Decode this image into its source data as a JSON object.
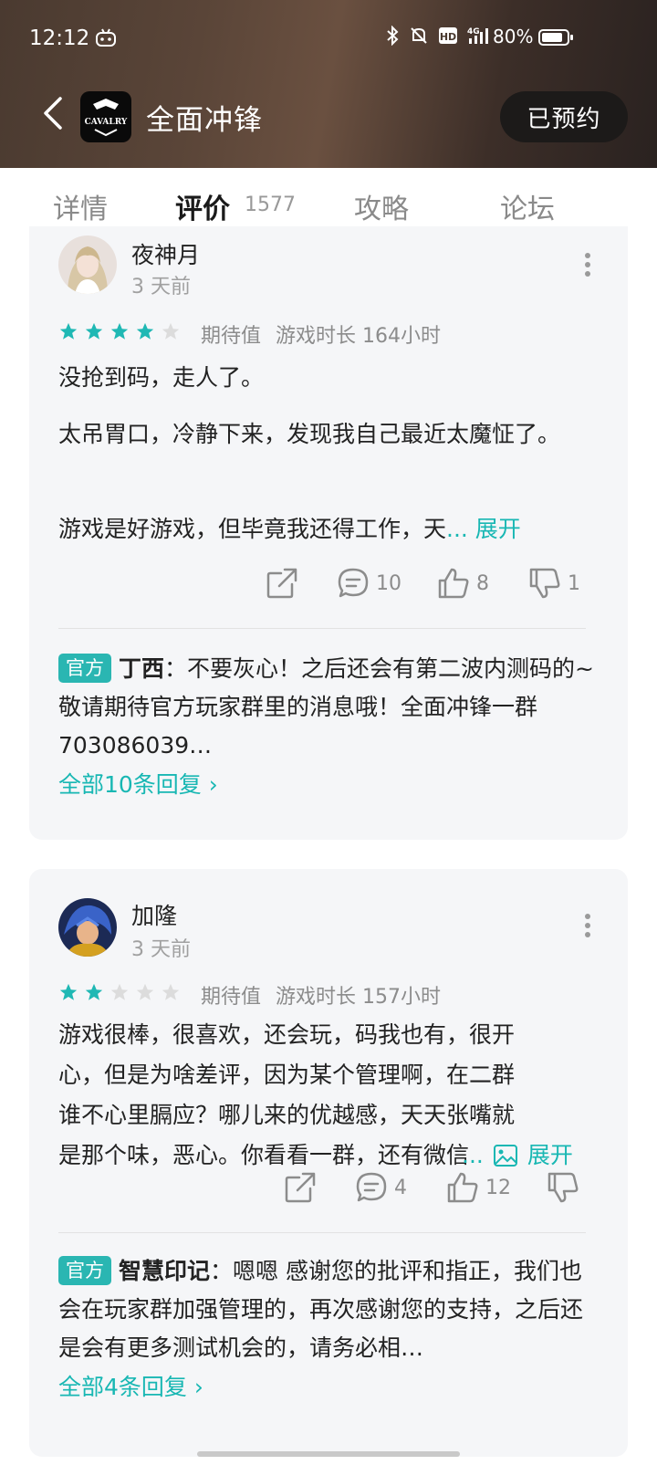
{
  "status_bar": {
    "time": "12:12",
    "battery": "80%",
    "icons": [
      "game-controller-icon",
      "bluetooth-icon",
      "mute-icon",
      "hd-icon",
      "4g-signal-icon",
      "battery-icon"
    ]
  },
  "header": {
    "title": "全面冲锋",
    "reserve_label": "已预约",
    "logo_text": "CAVALRY"
  },
  "tabs": [
    {
      "label": "详情"
    },
    {
      "label": "评价",
      "count": "1577",
      "active": true
    },
    {
      "label": "攻略"
    },
    {
      "label": "论坛"
    }
  ],
  "reviews": [
    {
      "user": "夜神月",
      "time": "3 天前",
      "stars": 4,
      "tag": "期待值",
      "playtime": "游戏时长 164小时",
      "paragraphs": [
        "没抢到码，走人了。",
        "太吊胃口，冷静下来，发现我自己最近太魔怔了。",
        "游戏是好游戏，但毕竟我还得工作，天"
      ],
      "expand_label": "... 展开",
      "comments": "10",
      "likes": "8",
      "dislikes": "1",
      "reply": {
        "badge": "官方",
        "author": "丁西",
        "text": "：不要灰心！之后还会有第二波内测码的~敬请期待官方玩家群里的消息哦！全面冲锋一群703086039…",
        "link": "全部10条回复 ›"
      }
    },
    {
      "user": "加隆",
      "time": "3 天前",
      "stars": 2,
      "tag": "期待值",
      "playtime": "游戏时长 157小时",
      "paragraphs": [
        "游戏很棒，很喜欢，还会玩，码我也有，很开心，但是为啥差评，因为某个管理啊，在二群谁不心里膈应？哪儿来的优越感，天天张嘴就是那个味，恶心。你看看一群，还有微信"
      ],
      "expand_label": "展开",
      "ellipsis": "...",
      "comments": "4",
      "likes": "12",
      "dislikes": "",
      "reply": {
        "badge": "官方",
        "author": "智慧印记",
        "text": "：嗯嗯 感谢您的批评和指正，我们也会在玩家群加强管理的，再次感谢您的支持，之后还是会有更多测试机会的，请务必相…",
        "link": "全部4条回复 ›"
      }
    }
  ],
  "colors": {
    "accent": "#18b7b3",
    "star_on": "#1fb8b4",
    "star_off": "#dcdcdc"
  }
}
